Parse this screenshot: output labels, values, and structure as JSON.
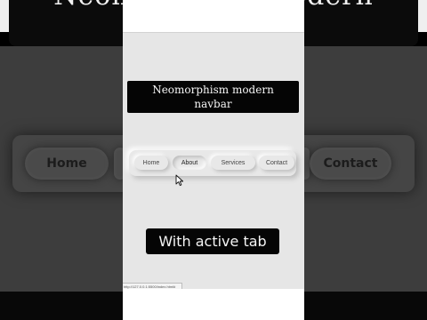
{
  "background": {
    "banner_text": "Neomorphism modern",
    "left_tab_label": "Home",
    "right_tab_label": "Contact"
  },
  "title_card": {
    "line1": "Neomorphism modern",
    "line2": "navbar"
  },
  "navbar": {
    "tabs": [
      {
        "label": "Home",
        "active": false
      },
      {
        "label": "About",
        "active": true
      },
      {
        "label": "Services",
        "active": false
      },
      {
        "label": "Contact",
        "active": false
      }
    ]
  },
  "subtitle": "With active tab",
  "status_bar": {
    "url": "http://127.0.0.1:5500/index.html#"
  },
  "colors": {
    "screen_bg": "#e6e6e6",
    "caption_bg": "#050505",
    "caption_text": "#f5f5f5"
  }
}
